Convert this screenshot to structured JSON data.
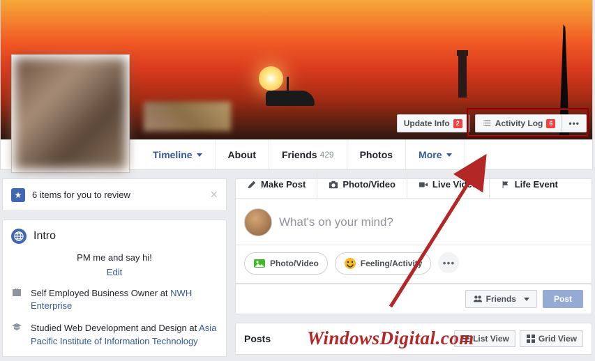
{
  "cover_actions": {
    "update_info": "Update Info",
    "update_badge": "2",
    "activity_log": "Activity Log",
    "activity_badge": "6"
  },
  "nav": {
    "timeline": "Timeline",
    "about": "About",
    "friends": "Friends",
    "friends_count": "429",
    "photos": "Photos",
    "more": "More"
  },
  "review": {
    "text": "6 items for you to review"
  },
  "intro": {
    "heading": "Intro",
    "tagline": "PM me and say hi!",
    "edit": "Edit",
    "work_prefix": "Self Employed Business Owner at ",
    "work_link": "NWH Enterprise",
    "edu_prefix": "Studied Web Development and Design at ",
    "edu_link": "Asia Pacific Institute of Information Technology"
  },
  "composer": {
    "tabs": {
      "make_post": "Make Post",
      "photo_video": "Photo/Video",
      "live_video": "Live Video",
      "life_event": "Life Event"
    },
    "placeholder": "What's on your mind?",
    "actions": {
      "photo_video": "Photo/Video",
      "feeling": "Feeling/Activity"
    }
  },
  "audience": {
    "friends": "Friends",
    "post": "Post"
  },
  "posts": {
    "title": "Posts",
    "list_view": "List View",
    "grid_view": "Grid View"
  },
  "watermark": "WindowsDigital.com"
}
